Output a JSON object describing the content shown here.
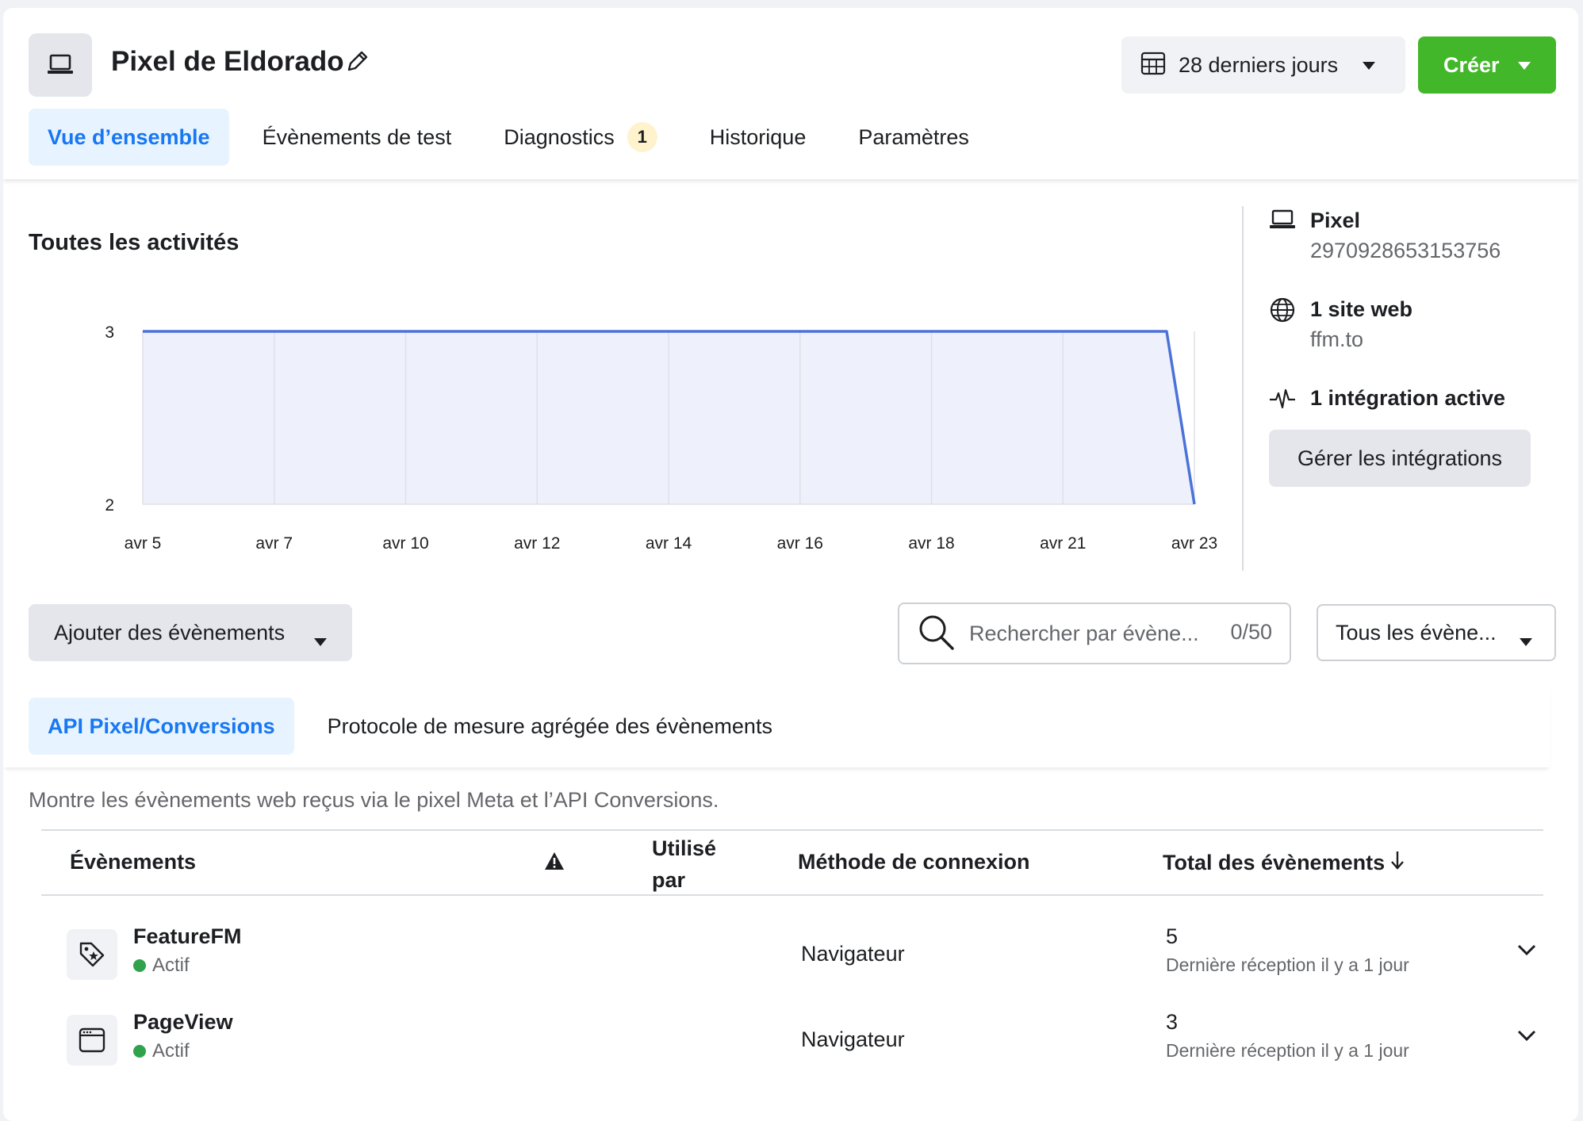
{
  "header": {
    "title": "Pixel de Eldorado",
    "date_range": "28 derniers jours",
    "create_label": "Créer",
    "tabs": [
      {
        "label": "Vue d’ensemble",
        "active": true
      },
      {
        "label": "Évènements de test"
      },
      {
        "label": "Diagnostics",
        "badge": "1"
      },
      {
        "label": "Historique"
      },
      {
        "label": "Paramètres"
      }
    ]
  },
  "activity": {
    "title": "Toutes les activités"
  },
  "chart_data": {
    "type": "area",
    "title": "Toutes les activités",
    "categories": [
      "avr 5",
      "avr 7",
      "avr 10",
      "avr 12",
      "avr 14",
      "avr 16",
      "avr 18",
      "avr 21",
      "avr 23"
    ],
    "series": [
      {
        "values": [
          3,
          3,
          3,
          3,
          3,
          3,
          3,
          3,
          2
        ]
      }
    ],
    "y_ticks": [
      2,
      3
    ],
    "ylim": [
      2,
      3
    ],
    "grid": true,
    "colors": {
      "line": "#4a72d8",
      "fill": "#eef1fb"
    }
  },
  "info": {
    "pixel_label": "Pixel",
    "pixel_id": "2970928653153756",
    "site_label": "1 site web",
    "site_url": "ffm.to",
    "integration_label": "1 intégration active",
    "manage_label": "Gérer les intégrations"
  },
  "controls": {
    "add_events_label": "Ajouter des évènements",
    "search_placeholder": "Rechercher par évène...",
    "search_count": "0/50",
    "filter_label": "Tous les évène..."
  },
  "subtabs": [
    {
      "label": "API Pixel/Conversions",
      "active": true
    },
    {
      "label": "Protocole de mesure agrégée des évènements"
    }
  ],
  "description": "Montre les évènements web reçus via le pixel Meta et l’API Conversions.",
  "table": {
    "headers": {
      "events": "Évènements",
      "used_by_line1": "Utilisé",
      "used_by_line2": "par",
      "method": "Méthode de connexion",
      "total": "Total des évènements"
    },
    "rows": [
      {
        "name": "FeatureFM",
        "status": "Actif",
        "method": "Navigateur",
        "total": "5",
        "last": "Dernière réception il y a 1 jour",
        "icon": "tag-star-icon"
      },
      {
        "name": "PageView",
        "status": "Actif",
        "method": "Navigateur",
        "total": "3",
        "last": "Dernière réception il y a 1 jour",
        "icon": "browser-window-icon"
      }
    ]
  },
  "colors": {
    "accent": "#1877f2",
    "create": "#42b72a",
    "active_dot": "#31a24c",
    "warning_badge": "#fff3cd"
  }
}
